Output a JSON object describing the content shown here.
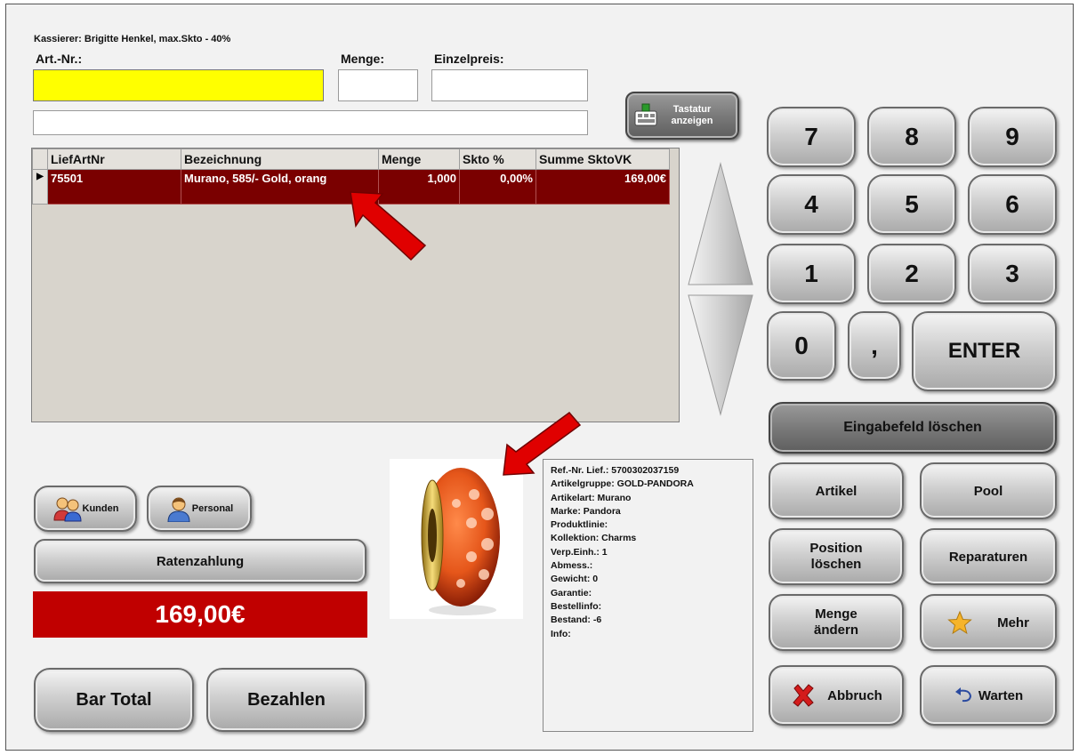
{
  "cashier": "Kassierer: Brigitte Henkel, max.Skto - 40%",
  "labels": {
    "art_nr": "Art.-Nr.:",
    "menge": "Menge:",
    "einzelpreis": "Einzelpreis:"
  },
  "fields": {
    "art_nr": "",
    "menge": "",
    "einzelpreis": "",
    "description": ""
  },
  "tastatur_button": "Tastatur anzeigen",
  "grid": {
    "columns": [
      "LiefArtNr",
      "Bezeichnung",
      "Menge",
      "Skto %",
      "Summe SktoVK"
    ],
    "rows": [
      {
        "selector": "▶",
        "liefartnr": "75501",
        "bezeichnung": "Murano, 585/- Gold, orang",
        "menge": "1,000",
        "skto": "0,00%",
        "summe": "169,00€"
      }
    ]
  },
  "left_buttons": {
    "kunden": "Kunden",
    "personal": "Personal",
    "ratenzahlung": "Ratenzahlung",
    "bar_total": "Bar Total",
    "bezahlen": "Bezahlen"
  },
  "total": "169,00€",
  "article_info": [
    "Ref.-Nr. Lief.: 5700302037159",
    "Artikelgruppe: GOLD-PANDORA",
    "Artikelart: Murano",
    "Marke: Pandora",
    "Produktlinie:",
    "Kollektion: Charms",
    "Verp.Einh.: 1",
    "Abmess.:",
    "Gewicht: 0",
    "Garantie:",
    "Bestellinfo:",
    "Bestand: -6",
    "Info:"
  ],
  "keypad": {
    "k7": "7",
    "k8": "8",
    "k9": "9",
    "k4": "4",
    "k5": "5",
    "k6": "6",
    "k1": "1",
    "k2": "2",
    "k3": "3",
    "k0": "0",
    "comma": ",",
    "enter": "ENTER"
  },
  "function_buttons": {
    "clear_input": "Eingabefeld löschen",
    "artikel": "Artikel",
    "pool": "Pool",
    "position_loeschen": "Position löschen",
    "reparaturen": "Reparaturen",
    "menge_aendern": "Menge ändern",
    "mehr": "Mehr",
    "abbruch": "Abbruch",
    "warten": "Warten"
  },
  "colors": {
    "selected_row": "#7a0000",
    "total_bg": "#c00000",
    "input_highlight": "#ffff00",
    "annotation_arrow": "#e00000"
  }
}
